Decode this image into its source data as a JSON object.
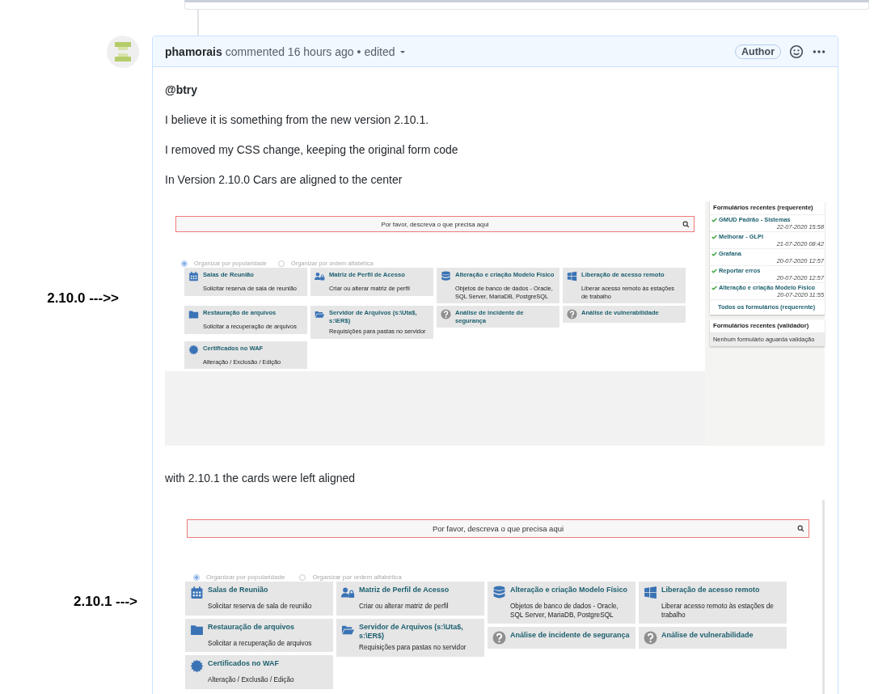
{
  "comment": {
    "author": "phamorais",
    "action": "commented",
    "time": "16 hours ago",
    "separator": "•",
    "edited": "edited",
    "badge": "Author",
    "body": [
      {
        "kind": "mention",
        "text": "@btry"
      },
      {
        "kind": "paragraph",
        "text": "I believe it is something from the new version 2.10.1."
      },
      {
        "kind": "paragraph",
        "text": "I removed my CSS change, keeping the original form code"
      },
      {
        "kind": "paragraph",
        "text": "In Version 2.10.0 Cars are aligned to the center"
      },
      {
        "kind": "screenshot",
        "side_label": "2.10.0 --->>",
        "search": {
          "placeholder": "Por favor, descreva o que precisa aqui"
        },
        "sort_options": [
          {
            "label": "Organizar por popularidade",
            "selected": true
          },
          {
            "label": "Organizar por ordem alfabética",
            "selected": false
          }
        ],
        "cards": [
          {
            "kind": "calendar",
            "title": "Salas de Reunião",
            "description": "Solicitar reserva de sala de reunião"
          },
          {
            "kind": "user",
            "title": "Matriz de Perfil de Acesso",
            "description": "Criar ou alterar matriz de perfil"
          },
          {
            "kind": "database",
            "title": "Alteração e criação Modelo Físico",
            "description": "Objetos de banco de dados - Oracle, SQL Server, MariaDB, PostgreSQL"
          },
          {
            "kind": "windows",
            "title": "Liberação de acesso remoto",
            "description": "Liberar acesso remoto às estações de trabalho"
          },
          {
            "kind": "folder",
            "title": "Restauração de arquivos",
            "description": "Solicitar a recuperação de arquivos"
          },
          {
            "kind": "share",
            "title": "Servidor de Arquivos (s:\\Uta$, s:\\ER$)",
            "description": "Requisições para pastas no servidor"
          },
          {
            "kind": "question",
            "title": "Análise de incidente de segurança"
          },
          {
            "kind": "question",
            "title": "Análise de vulnerabilidade"
          },
          {
            "kind": "certificate",
            "title": "Certificados no WAF",
            "description": "Alteração / Exclusão / Edição"
          }
        ],
        "sidebar": [
          {
            "title": "Formulários recentes (requerente)",
            "items": [
              {
                "name": "GMUD Padrão - Sistemas",
                "date": "22-07-2020 15:58"
              },
              {
                "name": "Melhorar - GLPI",
                "date": "21-07-2020 08:42"
              },
              {
                "name": "Grafana",
                "date": "20-07-2020 12:57"
              },
              {
                "name": "Reportar erros",
                "date": "20-07-2020 12:57"
              },
              {
                "name": "Alteração e criação Modelo Físico",
                "date": "20-07-2020 11:55"
              }
            ],
            "link": "Todos os formulários (requerente)"
          },
          {
            "title": "Formulários recentes (validador)",
            "empty": "Nenhum formulário aguarda validação"
          }
        ]
      },
      {
        "kind": "paragraph",
        "text": "with 2.10.1 the cards were left aligned"
      },
      {
        "kind": "screenshot",
        "side_label": "2.10.1 --->",
        "search": {
          "placeholder": "Por favor, descreva o que precisa aqui"
        },
        "sort_options": [
          {
            "label": "Organizar por popularidade",
            "selected": true
          },
          {
            "label": "Organizar por ordem alfabética",
            "selected": false
          }
        ],
        "cards": [
          {
            "kind": "calendar",
            "title": "Salas de Reunião",
            "description": "Solicitar reserva de sala de reunião"
          },
          {
            "kind": "user",
            "title": "Matriz de Perfil de Acesso",
            "description": "Criar ou alterar matriz de perfil"
          },
          {
            "kind": "database",
            "title": "Alteração e criação Modelo Físico",
            "description": "Objetos de banco de dados - Oracle, SQL Server, MariaDB, PostgreSQL"
          },
          {
            "kind": "windows",
            "title": "Liberação de acesso remoto",
            "description": "Liberar acesso remoto às estações de trabalho"
          },
          {
            "kind": "folder",
            "title": "Restauração de arquivos",
            "description": "Solicitar a recuperação de arquivos"
          },
          {
            "kind": "share",
            "title": "Servidor de Arquivos (s:\\Uta$, s:\\ER$)",
            "description": "Requisições para pastas no servidor"
          },
          {
            "kind": "question",
            "title": "Análise de incidente de segurança"
          },
          {
            "kind": "question",
            "title": "Análise de vulnerabilidade"
          },
          {
            "kind": "certificate",
            "title": "Certificados no WAF",
            "description": "Alteração / Exclusão / Edição"
          }
        ]
      }
    ]
  }
}
